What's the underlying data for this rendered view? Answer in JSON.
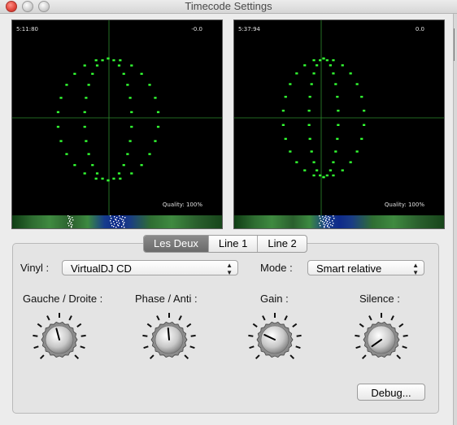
{
  "window": {
    "title": "Timecode Settings"
  },
  "scopes": [
    {
      "time": "5:11:80",
      "offset": "-0.0",
      "quality": "Quality: 100%"
    },
    {
      "time": "5:37:94",
      "offset": "0.0",
      "quality": "Quality: 100%"
    }
  ],
  "tabs": [
    "Les Deux",
    "Line 1",
    "Line 2"
  ],
  "active_tab": "Les Deux",
  "vinyl": {
    "label": "Vinyl :",
    "value": "VirtualDJ CD"
  },
  "mode": {
    "label": "Mode :",
    "value": "Smart relative"
  },
  "knobs": [
    {
      "label": "Gauche / Droite :",
      "angle_deg": -15
    },
    {
      "label": "Phase / Anti :",
      "angle_deg": -5
    },
    {
      "label": "Gain :",
      "angle_deg": -65
    },
    {
      "label": "Silence :",
      "angle_deg": -125
    }
  ],
  "debug_button": "Debug...",
  "colors": {
    "scope_trace": "#33ff33",
    "scope_bg": "#000000",
    "grid": "#2e8b2e"
  }
}
